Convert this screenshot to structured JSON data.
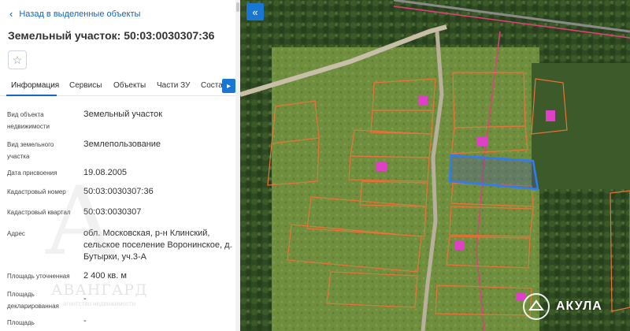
{
  "panel": {
    "back_label": "Назад в выделенные объекты",
    "title": "Земельный участок: 50:03:0030307:36",
    "tabs": [
      "Информация",
      "Сервисы",
      "Объекты",
      "Части ЗУ",
      "Соста"
    ],
    "active_tab": "Информация",
    "rows": [
      {
        "label": "Вид объекта недвижимости",
        "value": "Земельный участок"
      },
      {
        "label": "Вид земельного участка",
        "value": "Землепользование"
      },
      {
        "label": "Дата присвоения",
        "value": "19.08.2005"
      },
      {
        "label": "Кадастровый номер",
        "value": "50:03:0030307:36"
      },
      {
        "label": "Кадастровый квартал",
        "value": "50:03:0030307"
      },
      {
        "label": "Адрес",
        "value": "обл. Московская, р-н Клинский, сельское поселение Воронинское, д. Бутырки, уч.3-А"
      },
      {
        "label": "Площадь уточненная",
        "value": "2 400 кв. м"
      },
      {
        "label": "Площадь декларированная",
        "value": "-"
      },
      {
        "label": "Площадь",
        "value": "-"
      }
    ]
  },
  "watermark": {
    "text": "АВАНГАРД",
    "sub": "агентство недвижимости"
  },
  "map": {
    "brand": "АКУЛА",
    "parcel_stroke": "#e8743a",
    "selected_stroke": "#2e7cf6",
    "building_fill": "#e040c8",
    "boundary_stroke": "#e0407a"
  }
}
